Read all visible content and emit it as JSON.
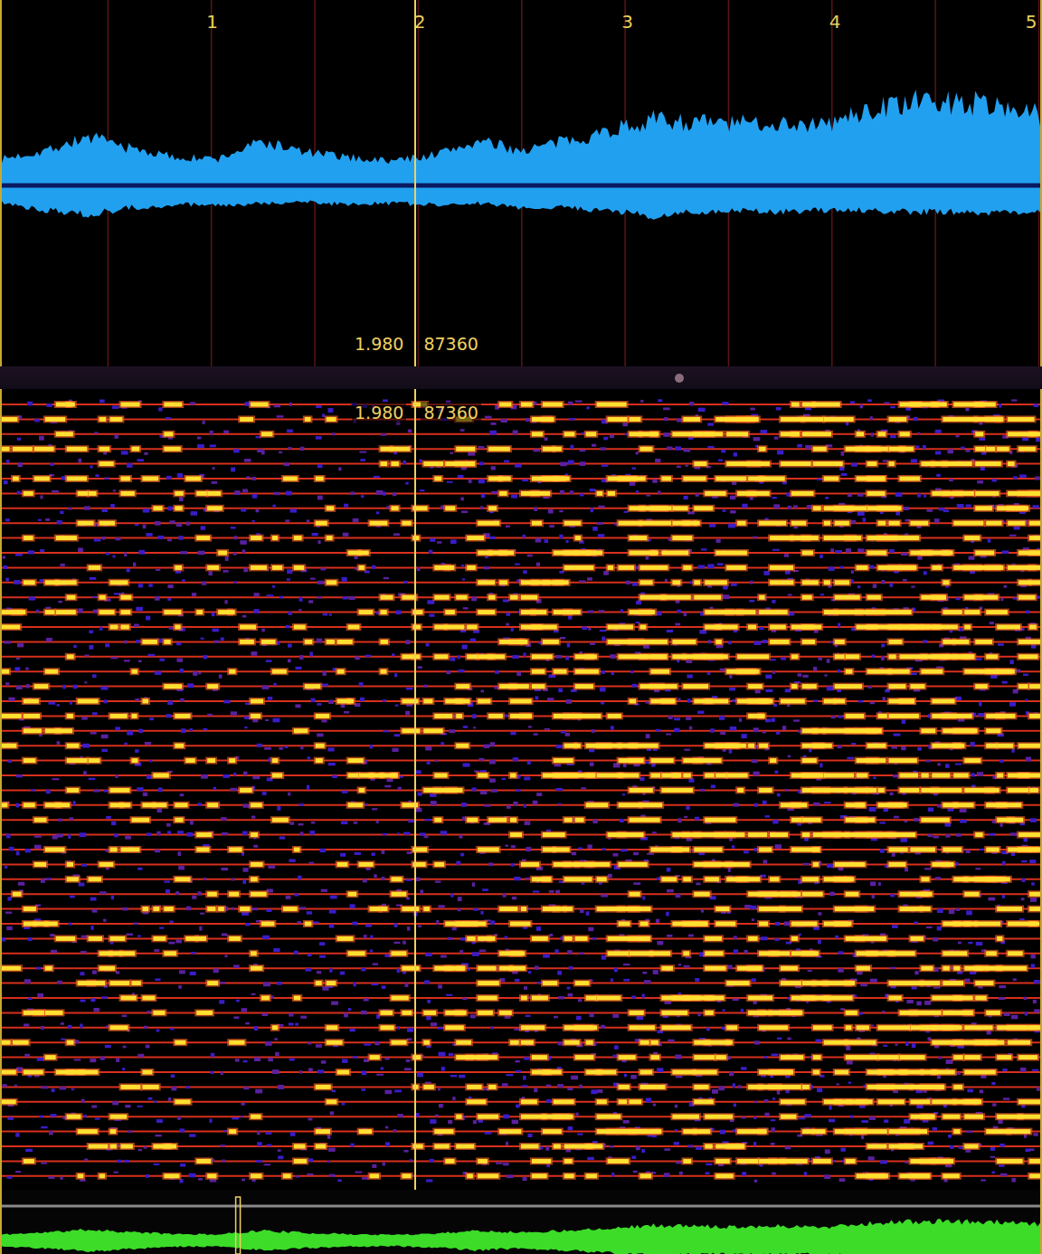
{
  "ruler": {
    "labels": [
      "1",
      "2",
      "3",
      "4",
      "5"
    ],
    "seconds_shown": 5
  },
  "cursor": {
    "time": "1.980",
    "sample": "87360"
  },
  "waveform": {
    "upper": [
      0.15,
      0.2,
      0.275,
      0.21,
      0.16,
      0.15,
      0.25,
      0.19,
      0.16,
      0.14,
      0.175,
      0.25,
      0.2,
      0.25,
      0.31,
      0.375,
      0.36,
      0.35,
      0.36,
      0.34,
      0.425,
      0.475,
      0.475,
      0.46,
      0.4
    ],
    "lower": [
      0.1,
      0.14,
      0.165,
      0.125,
      0.11,
      0.11,
      0.1,
      0.09,
      0.11,
      0.1,
      0.11,
      0.1,
      0.125,
      0.125,
      0.14,
      0.175,
      0.15,
      0.14,
      0.15,
      0.14,
      0.14,
      0.15,
      0.15,
      0.16,
      0.14
    ]
  },
  "spectrogram": {
    "bins": 53,
    "energy": [
      0.4,
      0.45,
      0.4,
      0.35,
      0.3,
      0.35,
      0.3,
      0.3,
      0.35,
      0.4,
      0.45,
      0.5,
      0.6,
      0.7,
      0.75,
      0.75,
      0.8,
      0.75,
      0.7,
      0.75,
      0.8,
      0.8,
      0.8,
      0.8
    ]
  },
  "overview": {
    "playhead_level": 0.227
  }
}
